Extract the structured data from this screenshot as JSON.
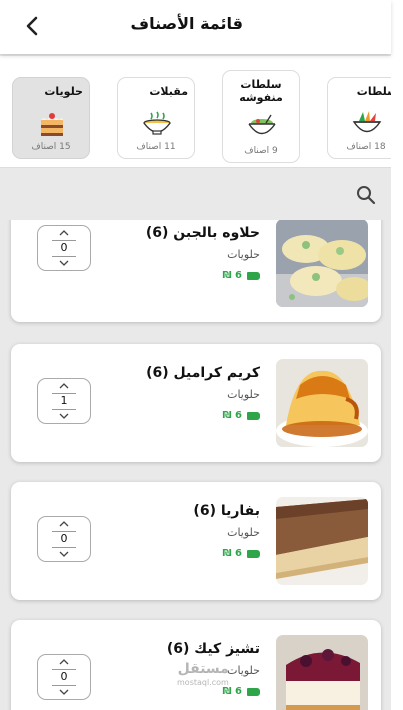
{
  "header": {
    "title": "قائمة الأصناف"
  },
  "categories": [
    {
      "name": "حلويات",
      "count": "15 اصناف",
      "icon": "cake-icon",
      "active": true
    },
    {
      "name": "مقبلات",
      "count": "11 اصناف",
      "icon": "bowl-icon",
      "active": false
    },
    {
      "name": "سلطات منفوشه",
      "count": "9 اصناف",
      "icon": "salad-bowl-icon",
      "active": false
    },
    {
      "name": "سلطات",
      "count": "18 اصناف",
      "icon": "salad-icon",
      "active": false
    }
  ],
  "products": [
    {
      "name": "حلاوه بالجبن (6)",
      "category": "حلويات",
      "price": "₪ 6",
      "qty": "0",
      "image": "halawa-jibn-photo"
    },
    {
      "name": "كريم كراميل (6)",
      "category": "حلويات",
      "price": "₪ 6",
      "qty": "1",
      "image": "creme-caramel-photo"
    },
    {
      "name": "بفاريا (6)",
      "category": "حلويات",
      "price": "₪ 6",
      "qty": "0",
      "image": "bavaria-photo"
    },
    {
      "name": "تشيز كيك (6)",
      "category": "حلويات",
      "price": "₪ 6",
      "qty": "0",
      "image": "cheesecake-photo"
    }
  ],
  "watermark": {
    "text": "مستقل",
    "sub": "mostaql.com"
  },
  "colors": {
    "price": "#2fa54a",
    "active_category": "#e2e2e2"
  }
}
